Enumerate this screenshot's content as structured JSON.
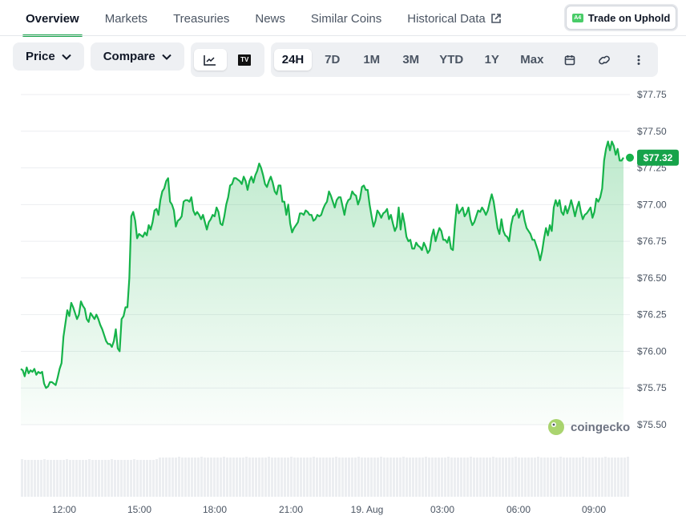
{
  "tabs": [
    {
      "label": "Overview",
      "active": true
    },
    {
      "label": "Markets"
    },
    {
      "label": "Treasuries"
    },
    {
      "label": "News"
    },
    {
      "label": "Similar Coins"
    },
    {
      "label": "Historical Data",
      "external": true
    }
  ],
  "trade_button": {
    "label": "Trade on Uphold",
    "logo_text": "A4"
  },
  "toolbar": {
    "price_label": "Price",
    "compare_label": "Compare",
    "chart_type_icons": [
      "line-chart-icon",
      "tradingview-icon"
    ],
    "tradingview_logo_text": "TV",
    "ranges": [
      "24H",
      "7D",
      "1M",
      "3M",
      "YTD",
      "1Y",
      "Max"
    ],
    "active_range": "24H",
    "action_icons": [
      "calendar-icon",
      "link-icon",
      "more-icon"
    ]
  },
  "colors": {
    "line": "#16b34a",
    "badge": "#16a34a",
    "accent": "#16a34a"
  },
  "watermark": "coingecko",
  "chart_data": {
    "type": "area",
    "y_ticks": [
      "$77.75",
      "$77.50",
      "$77.25",
      "$77.00",
      "$76.75",
      "$76.50",
      "$76.25",
      "$76.00",
      "$75.75",
      "$75.50"
    ],
    "ylim": [
      75.5,
      77.75
    ],
    "x_ticks": [
      "12:00",
      "15:00",
      "18:00",
      "21:00",
      "19. Aug",
      "03:00",
      "06:00",
      "09:00"
    ],
    "current_price_label": "$77.32",
    "current_price": 77.32,
    "series": [
      {
        "values": [
          75.88,
          75.87,
          75.83,
          75.89,
          75.85,
          75.87,
          75.86,
          75.88,
          75.84,
          75.86,
          75.85,
          75.86,
          75.78,
          75.75,
          75.76,
          75.79,
          75.79,
          75.78,
          75.77,
          75.82,
          75.88,
          75.92,
          76.1,
          76.19,
          76.28,
          76.24,
          76.33,
          76.3,
          76.26,
          76.22,
          76.25,
          76.34,
          76.31,
          76.29,
          76.22,
          76.2,
          76.26,
          76.24,
          76.22,
          76.25,
          76.22,
          76.18,
          76.15,
          76.11,
          76.07,
          76.05,
          76.05,
          76.03,
          76.07,
          76.15,
          76.02,
          76.0,
          76.22,
          76.24,
          76.3,
          76.3,
          76.5,
          76.92,
          76.95,
          76.89,
          76.77,
          76.8,
          76.79,
          76.78,
          76.81,
          76.79,
          76.86,
          76.83,
          76.88,
          76.96,
          76.97,
          76.93,
          77.03,
          77.09,
          77.11,
          77.16,
          77.18,
          77.02,
          77.0,
          76.96,
          76.85,
          76.89,
          76.9,
          76.92,
          77.02,
          77.03,
          77.03,
          77.02,
          77.05,
          76.96,
          76.93,
          76.95,
          76.93,
          76.9,
          76.93,
          76.88,
          76.83,
          76.88,
          76.9,
          76.93,
          76.92,
          76.98,
          76.95,
          76.87,
          76.86,
          76.92,
          77.0,
          77.05,
          77.13,
          77.14,
          77.18,
          77.18,
          77.17,
          77.16,
          77.14,
          77.19,
          77.16,
          77.1,
          77.16,
          77.19,
          77.15,
          77.2,
          77.23,
          77.28,
          77.25,
          77.2,
          77.14,
          77.12,
          77.16,
          77.19,
          77.15,
          77.09,
          77.07,
          77.13,
          77.13,
          77.02,
          77.02,
          76.93,
          77.0,
          76.87,
          76.81,
          76.84,
          76.86,
          76.88,
          76.94,
          76.94,
          76.93,
          76.96,
          76.95,
          76.93,
          76.93,
          76.89,
          76.9,
          76.93,
          76.92,
          76.93,
          76.97,
          77.0,
          77.02,
          77.09,
          77.06,
          77.02,
          76.98,
          77.03,
          77.05,
          77.05,
          76.99,
          76.93,
          77.0,
          77.03,
          77.04,
          77.09,
          77.07,
          77.06,
          77.0,
          77.04,
          77.12,
          77.13,
          77.1,
          77.1,
          77.0,
          76.92,
          76.85,
          76.89,
          76.96,
          76.94,
          76.91,
          76.94,
          76.95,
          76.97,
          76.9,
          76.93,
          76.87,
          76.82,
          76.85,
          76.98,
          76.83,
          76.94,
          76.87,
          76.78,
          76.75,
          76.76,
          76.7,
          76.7,
          76.74,
          76.72,
          76.71,
          76.69,
          76.74,
          76.71,
          76.67,
          76.69,
          76.78,
          76.83,
          76.75,
          76.8,
          76.84,
          76.82,
          76.76,
          76.76,
          76.74,
          76.78,
          76.7,
          76.69,
          76.86,
          77.0,
          76.94,
          76.96,
          76.98,
          76.92,
          76.94,
          76.98,
          76.9,
          76.86,
          76.88,
          76.92,
          76.96,
          76.95,
          76.98,
          76.96,
          76.93,
          76.96,
          77.02,
          77.07,
          77.02,
          76.93,
          76.84,
          76.8,
          76.9,
          76.82,
          76.79,
          76.78,
          76.75,
          76.86,
          76.92,
          76.93,
          76.97,
          76.91,
          76.95,
          76.96,
          76.89,
          76.84,
          76.82,
          76.8,
          76.76,
          76.76,
          76.72,
          76.68,
          76.62,
          76.68,
          76.77,
          76.84,
          76.79,
          76.86,
          76.82,
          76.98,
          77.03,
          76.99,
          77.03,
          76.95,
          76.93,
          76.99,
          76.94,
          76.98,
          77.03,
          76.98,
          76.92,
          76.98,
          77.02,
          76.95,
          76.9,
          76.93,
          76.94,
          76.96,
          76.98,
          76.91,
          76.95,
          77.04,
          77.02,
          77.05,
          77.11,
          77.3,
          77.38,
          77.43,
          77.37,
          77.43,
          77.4,
          77.34,
          77.38,
          77.3,
          77.3,
          77.32
        ]
      }
    ]
  }
}
